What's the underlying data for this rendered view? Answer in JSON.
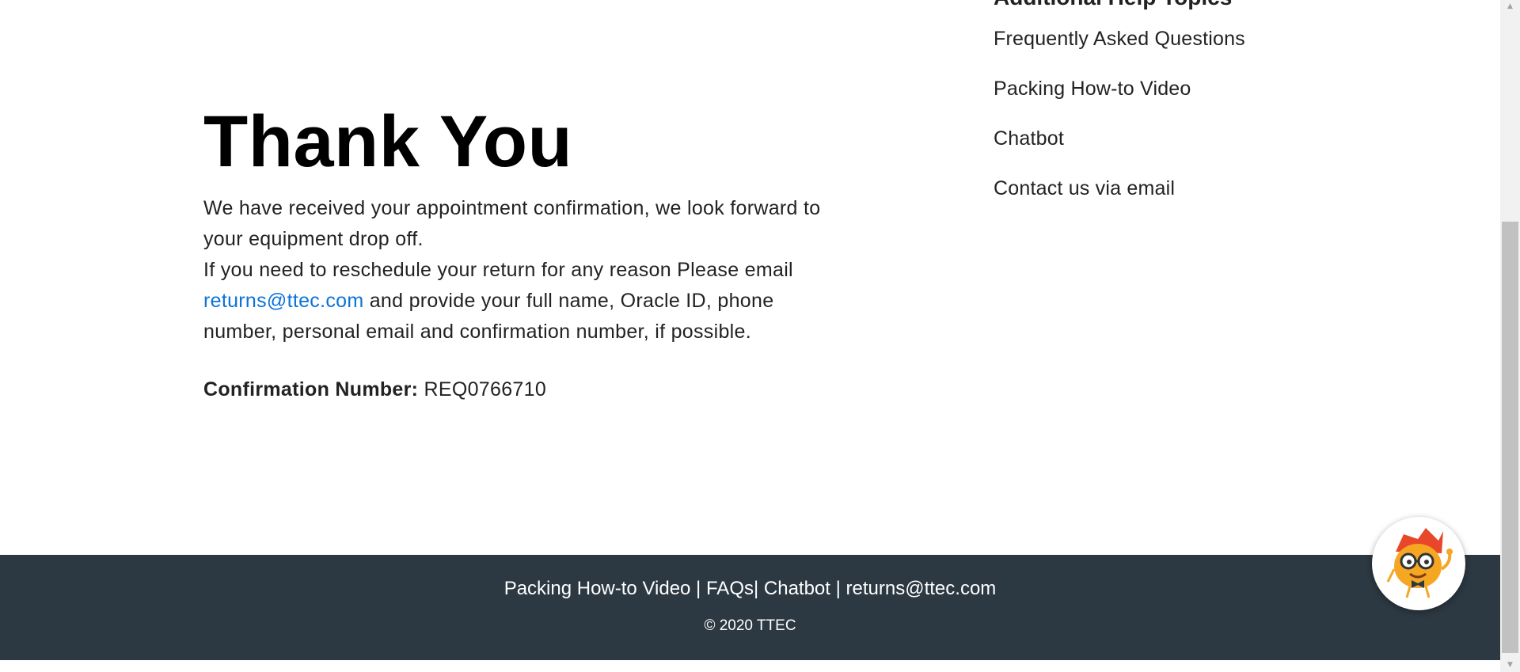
{
  "main": {
    "title": "Thank You",
    "paragraph1": "We have received your appointment confirmation, we look forward to your equipment drop off.",
    "paragraph2_prefix": "If you need to reschedule your return for any reason Please email",
    "email_link": "returns@ttec.com",
    "paragraph2_suffix": "and provide your full name, Oracle ID, phone number, personal email and confirmation number, if possible.",
    "confirmation_label": "Confirmation Number:",
    "confirmation_value": "REQ0766710"
  },
  "help": {
    "heading": "Additional Help Topics",
    "items": [
      {
        "label": "Frequently Asked Questions"
      },
      {
        "label": "Packing How-to Video"
      },
      {
        "label": "Chatbot"
      },
      {
        "label": "Contact us via email"
      }
    ]
  },
  "footer": {
    "link_packing": "Packing How-to Video",
    "sep1": " | ",
    "link_faqs": "FAQs",
    "sep2": "| ",
    "link_chatbot": "Chatbot",
    "sep3": " | ",
    "link_email": "returns@ttec.com",
    "copyright": "© 2020 TTEC"
  },
  "colors": {
    "footer_bg": "#2c3842",
    "link": "#0a73d8",
    "mascot_orange": "#f5a623",
    "mascot_hair": "#e8472a"
  },
  "icons": {
    "chatbot": "chatbot-mascot-icon",
    "scroll_up": "scroll-up-arrow-icon",
    "scroll_down": "scroll-down-arrow-icon"
  }
}
